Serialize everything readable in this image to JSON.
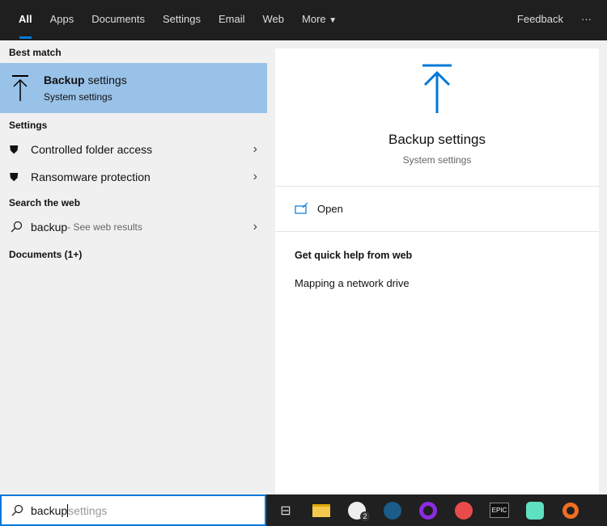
{
  "tabs": [
    "All",
    "Apps",
    "Documents",
    "Settings",
    "Email",
    "Web",
    "More"
  ],
  "feedback": "Feedback",
  "more_options": "···",
  "left": {
    "best_match_header": "Best match",
    "best": {
      "title_bold": "Backup",
      "title_rest": " settings",
      "subtitle": "System settings"
    },
    "settings_header": "Settings",
    "settings_items": [
      "Controlled folder access",
      "Ransomware protection"
    ],
    "web_header": "Search the web",
    "web_item": {
      "query": "backup",
      "hint": " - See web results"
    },
    "documents_header": "Documents (1+)"
  },
  "detail": {
    "title": "Backup settings",
    "subtitle": "System settings",
    "open": "Open",
    "help_header": "Get quick help from web",
    "help_link": "Mapping a network drive"
  },
  "search": {
    "typed": "backup",
    "suggestion": "settings"
  },
  "taskbar": {
    "xbox_badge": "2",
    "epic_label": "EPIC"
  },
  "colors": {
    "accent": "#0078d7",
    "selected": "#99c2e8"
  }
}
